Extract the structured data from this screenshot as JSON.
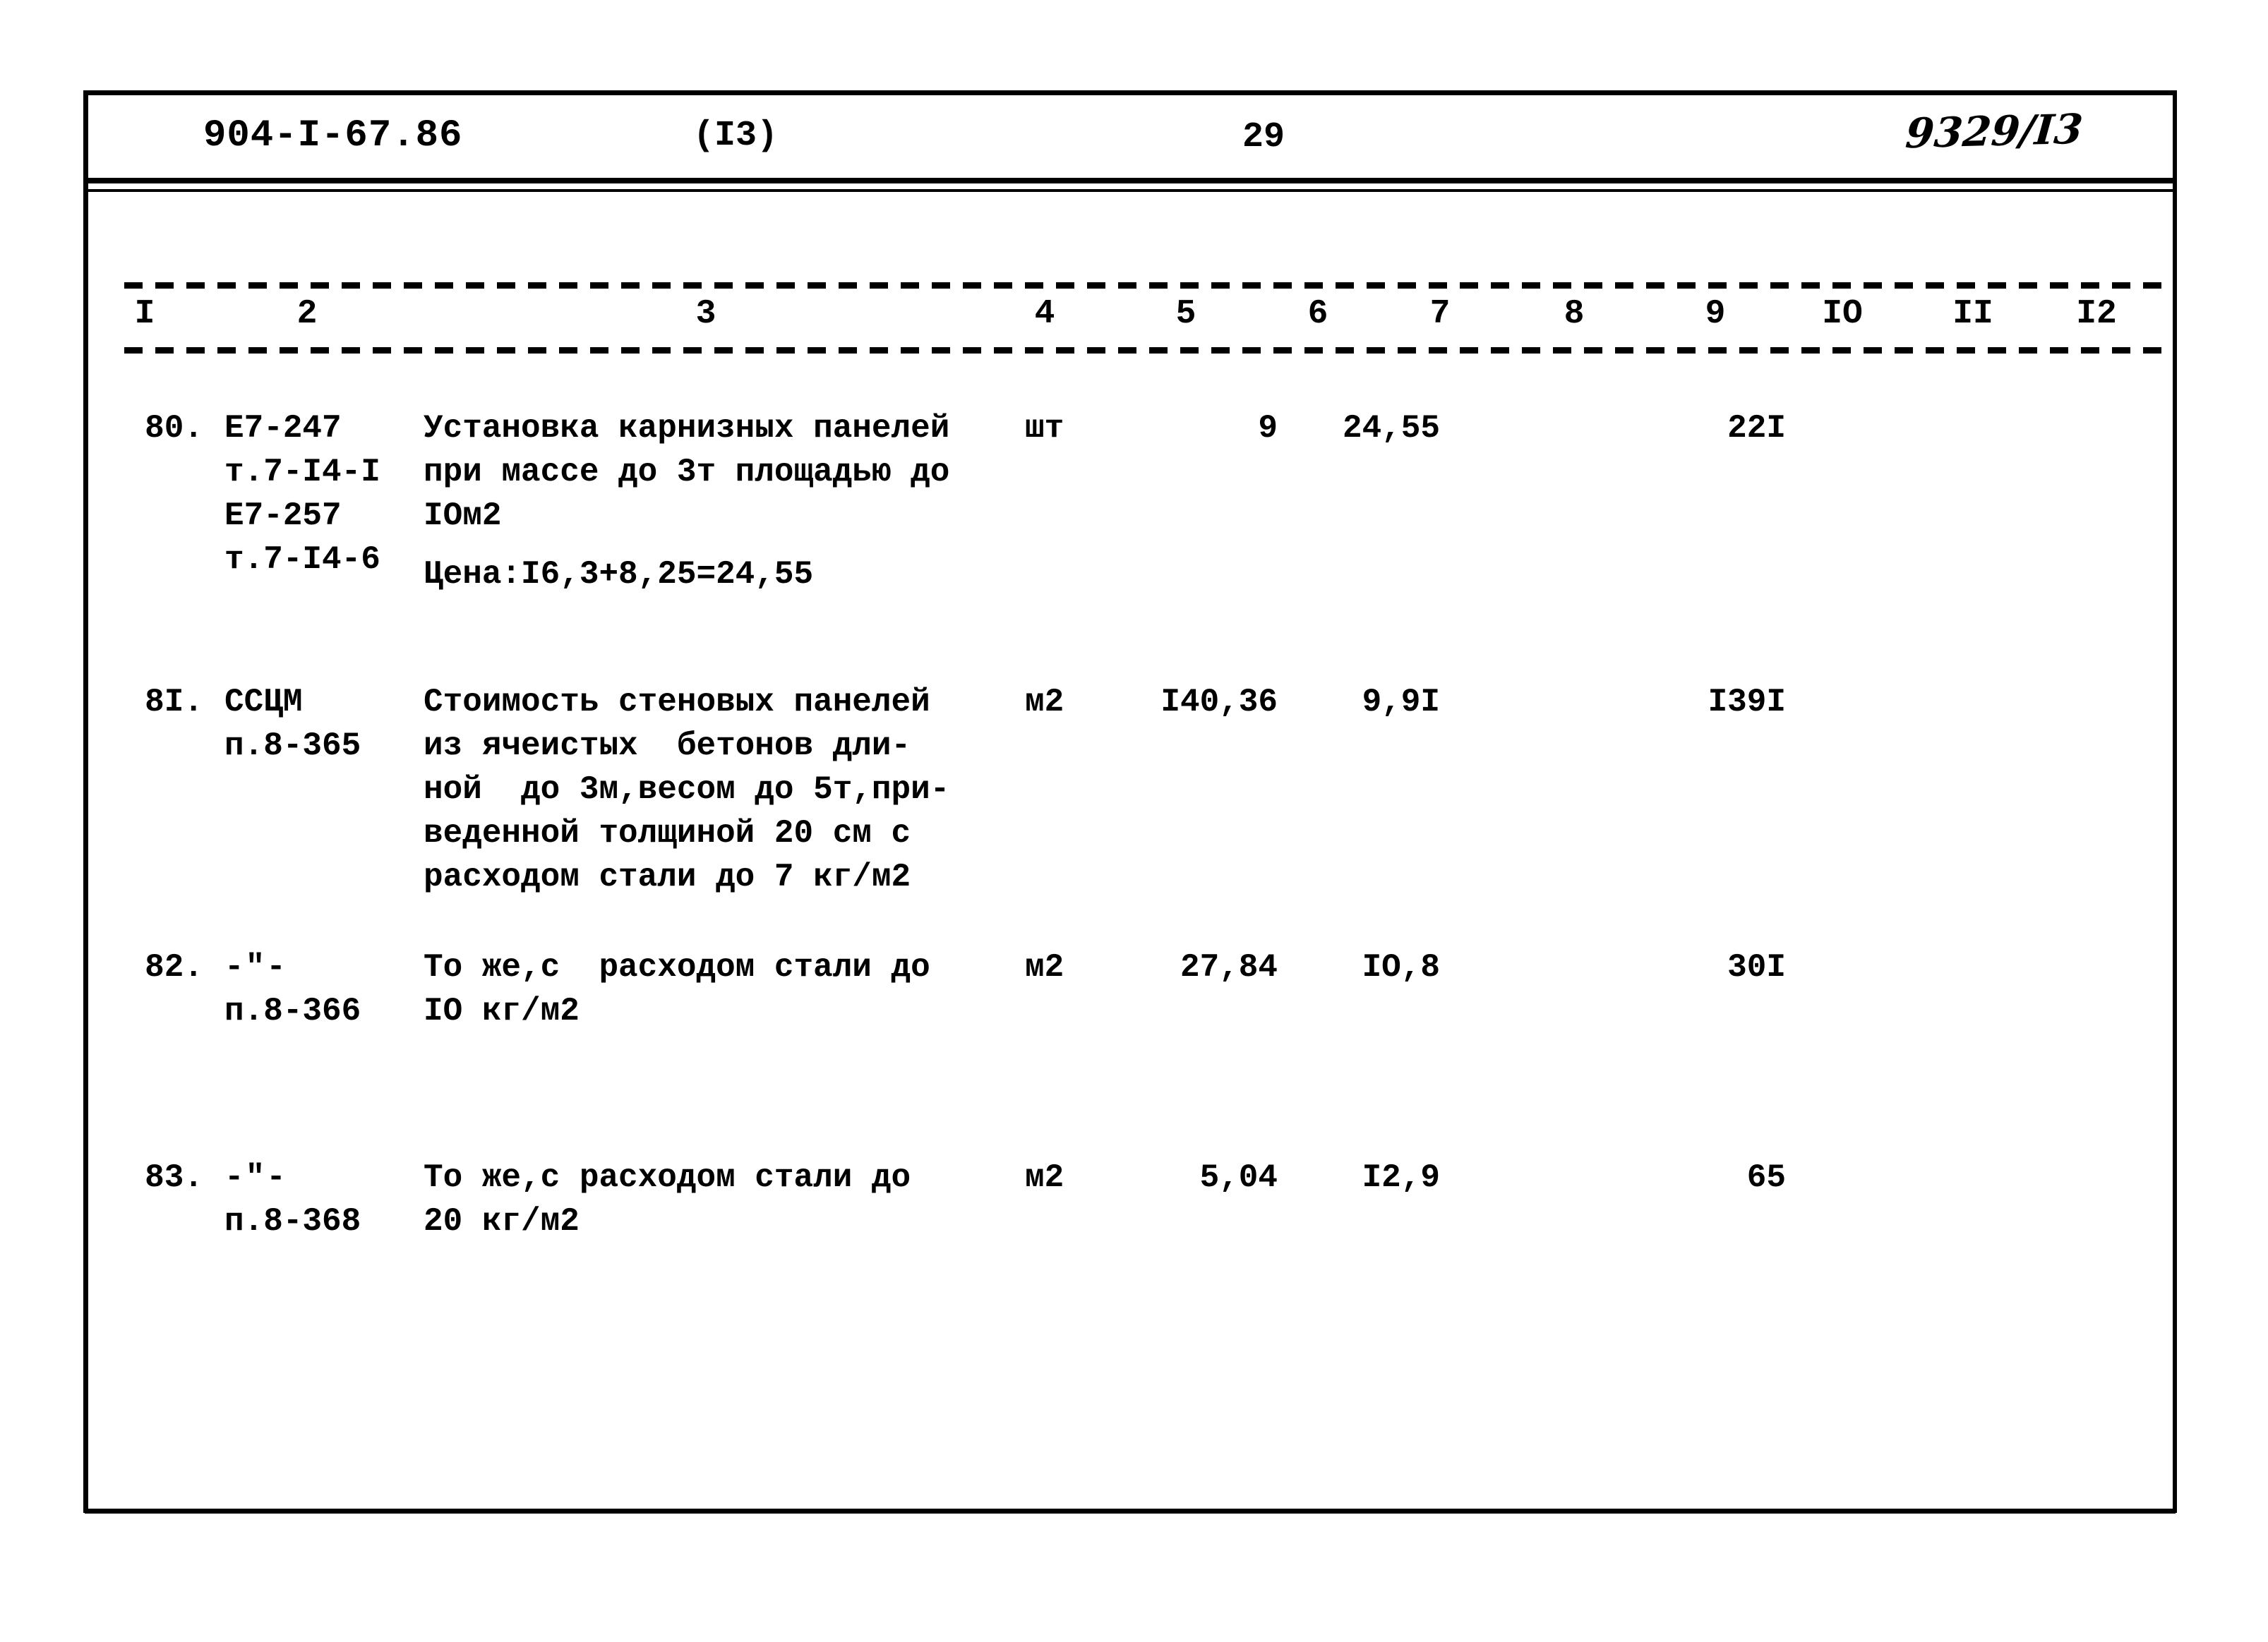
{
  "header": {
    "doc_number": "904-I-67.86",
    "section": "(I3)",
    "page_number": "29",
    "stamp": "9329/I3"
  },
  "table": {
    "column_numbers": [
      "I",
      "2",
      "3",
      "4",
      "5",
      "6",
      "7",
      "8",
      "9",
      "IO",
      "II",
      "I2"
    ],
    "rows": [
      {
        "num": "80.",
        "code_lines": [
          "Е7-247",
          "т.7-I4-I",
          "Е7-257",
          "т.7-I4-6"
        ],
        "desc_lines": [
          "Установка карнизных панелей",
          "при массе до 3т площадью до",
          "IОм2"
        ],
        "unit": "шт",
        "qty": "9",
        "price": "24,55",
        "col7": "",
        "col8": "",
        "col9": "22I",
        "col10": "",
        "col11": "",
        "col12": "",
        "note": "Цена:I6,3+8,25=24,55"
      },
      {
        "num": "8I.",
        "code_lines": [
          "ССЦМ",
          "п.8-365"
        ],
        "desc_lines": [
          "Стоимость стеновых панелей",
          "из ячеистых  бетонов дли-",
          "ной  до 3м,весом до 5т,при-",
          "веденной толщиной 20 см с",
          "расходом стали до 7 кг/м2"
        ],
        "unit": "м2",
        "qty": "I40,36",
        "price": "9,9I",
        "col7": "",
        "col8": "",
        "col9": "I39I",
        "col10": "",
        "col11": "",
        "col12": "",
        "note": ""
      },
      {
        "num": "82.",
        "code_lines": [
          "-\"-",
          "п.8-366"
        ],
        "desc_lines": [
          "То же,с  расходом стали до",
          "IО кг/м2"
        ],
        "unit": "м2",
        "qty": "27,84",
        "price": "IО,8",
        "col7": "",
        "col8": "",
        "col9": "30I",
        "col10": "",
        "col11": "",
        "col12": "",
        "note": ""
      },
      {
        "num": "83.",
        "code_lines": [
          "-\"-",
          "п.8-368"
        ],
        "desc_lines": [
          "То же,с расходом стали до",
          "20 кг/м2"
        ],
        "unit": "м2",
        "qty": "5,04",
        "price": "I2,9",
        "col7": "",
        "col8": "",
        "col9": "65",
        "col10": "",
        "col11": "",
        "col12": "",
        "note": ""
      }
    ]
  }
}
